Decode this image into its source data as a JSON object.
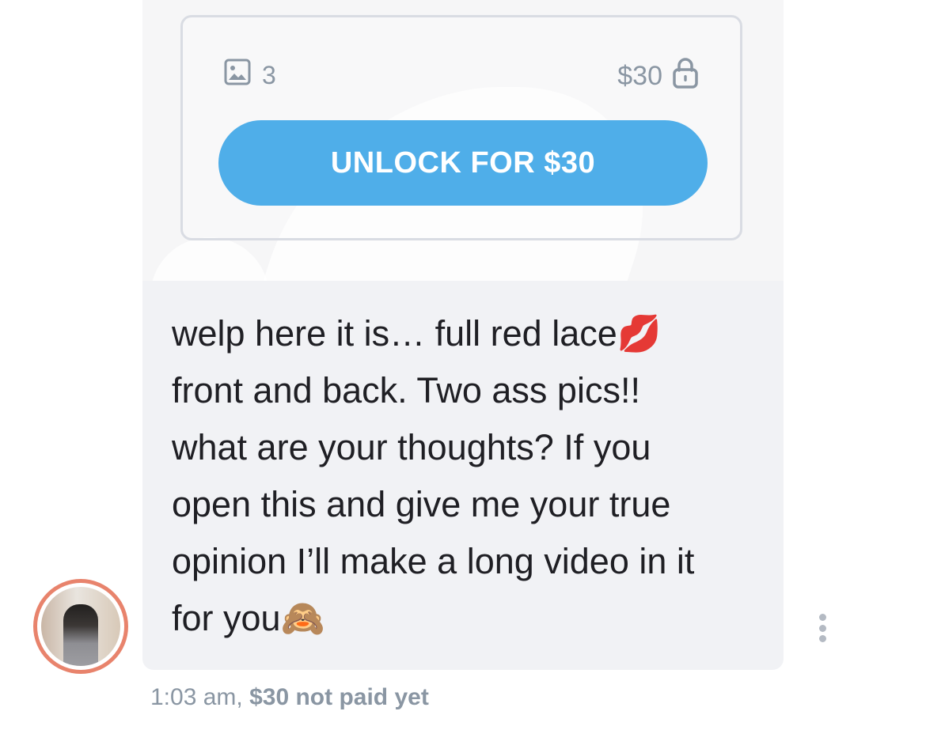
{
  "locked_post": {
    "media_count": "3",
    "price": "$30",
    "unlock_button_label": "UNLOCK FOR $30",
    "accent_color": "#4faee9",
    "icons": {
      "media": "image-icon",
      "price": "lock-icon"
    }
  },
  "message": {
    "text_main": "welp here it is… full red lace",
    "emoji_1": "💋",
    "text_rest": "\nfront and back. Two ass pics!!\nwhat are your thoughts? If you\nopen this and give me your true\nopinion I’ll make a long video in it\nfor you",
    "emoji_2": "🙈"
  },
  "meta": {
    "time": "1:03 am,",
    "payment_status": "$30 not paid yet"
  },
  "icons": {
    "avatar": "avatar",
    "more": "more-vertical-icon"
  }
}
